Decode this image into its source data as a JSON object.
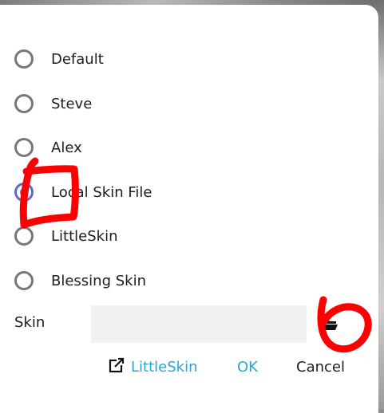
{
  "options": [
    {
      "label": "Default",
      "checked": false
    },
    {
      "label": "Steve",
      "checked": false
    },
    {
      "label": "Alex",
      "checked": false
    },
    {
      "label": "Local Skin File",
      "checked": true
    },
    {
      "label": "LittleSkin",
      "checked": false
    },
    {
      "label": "Blessing Skin",
      "checked": false
    }
  ],
  "skin_field": {
    "label": "Skin",
    "value": "",
    "placeholder": ""
  },
  "buttons": {
    "littleskin_link": "LittleSkin",
    "ok": "OK",
    "cancel": "Cancel"
  },
  "icons": {
    "browse": "folder-open-icon",
    "external_link": "external-link-icon"
  },
  "colors": {
    "accent": "#27a7d9",
    "radio_selected": "#5b6bd1",
    "annotation": "#ff0000"
  }
}
